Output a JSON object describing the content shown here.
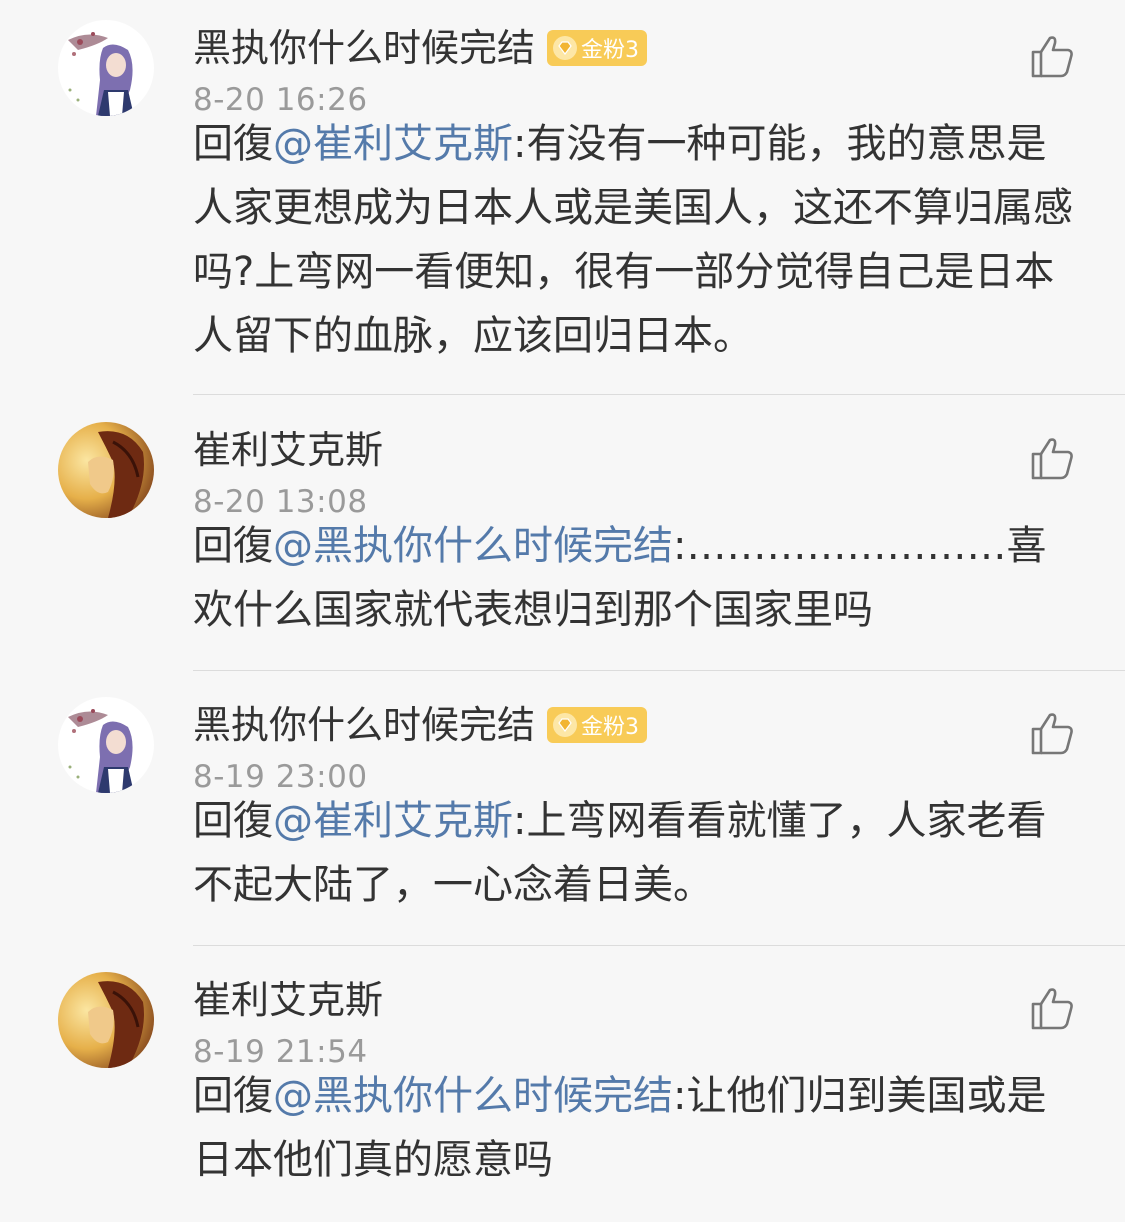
{
  "comments": [
    {
      "username": "黑执你什么时候完结",
      "badge": "金粉3",
      "timestamp": "8-20 16:26",
      "reply_prefix": "回復",
      "mention": "@崔利艾克斯",
      "text": ":有没有一种可能，我的意思是人家更想成为日本人或是美国人，这还不算归属感吗?上弯网一看便知，很有一部分觉得自己是日本人留下的血脉，应该回归日本。"
    },
    {
      "username": "崔利艾克斯",
      "timestamp": "8-20 13:08",
      "reply_prefix": "回復",
      "mention": "@黑执你什么时候完结",
      "text": ":……………………喜欢什么国家就代表想归到那个国家里吗"
    },
    {
      "username": "黑执你什么时候完结",
      "badge": "金粉3",
      "timestamp": "8-19 23:00",
      "reply_prefix": "回復",
      "mention": "@崔利艾克斯",
      "text": ":上弯网看看就懂了，人家老看不起大陆了，一心念着日美。"
    },
    {
      "username": "崔利艾克斯",
      "timestamp": "8-19 21:54",
      "reply_prefix": "回復",
      "mention": "@黑执你什么时候完结",
      "text": ":让他们归到美国或是日本他们真的愿意吗"
    }
  ],
  "icons": {
    "like": "thumbs-up-icon",
    "badge": "diamond-icon"
  },
  "colors": {
    "mention": "#547aaa",
    "badge": "#f8cb57",
    "timestamp": "#9a9a9a",
    "background": "#f7f7f7"
  }
}
